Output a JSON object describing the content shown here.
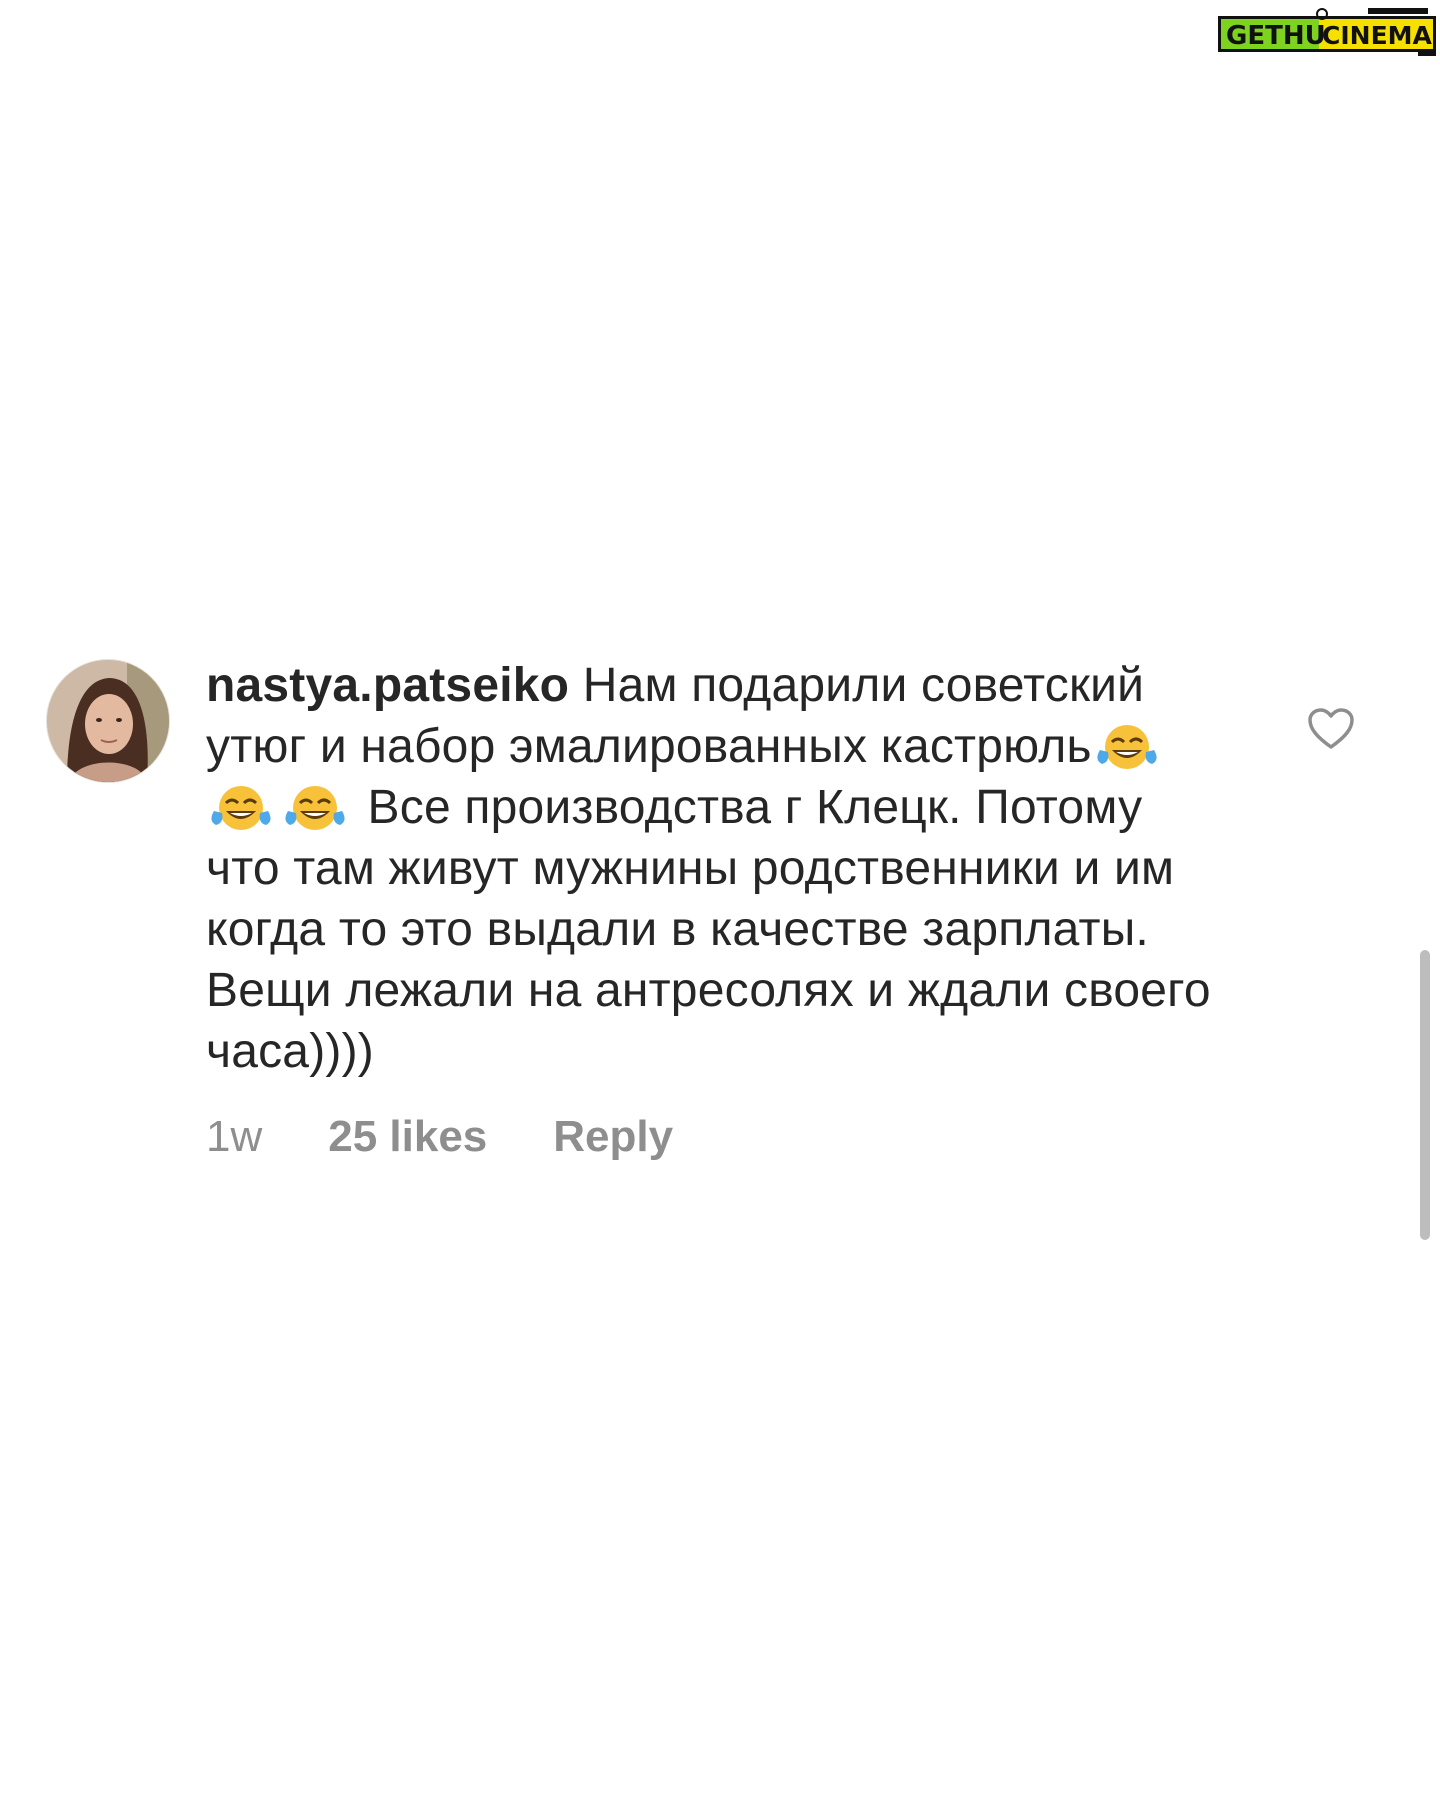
{
  "watermark": {
    "text_left": "GETHU",
    "text_right": "CINEMA",
    "colors": {
      "green": "#7ed321",
      "yellow": "#f6e000",
      "dark": "#111111"
    }
  },
  "comment": {
    "avatar_icon": "profile-photo",
    "username": "nastya.patseiko",
    "text_part1": " Нам подарили советский утюг и набор эмалированных кастрюль",
    "emojis": [
      "face-with-tears-of-joy",
      "face-with-tears-of-joy",
      "face-with-tears-of-joy"
    ],
    "text_part2": " Все производства г Клецк. Потому что там живут мужнины родственники и им когда то это выдали в качестве зарплаты. Вещи лежали на антресолях и ждали своего часа))))",
    "time": "1w",
    "likes": "25 likes",
    "reply_label": "Reply",
    "like_icon": "heart-outline-icon"
  },
  "colors": {
    "text": "#262626",
    "meta": "#8e8e8e",
    "scrollbar": "#bdbdbd",
    "background": "#ffffff"
  }
}
